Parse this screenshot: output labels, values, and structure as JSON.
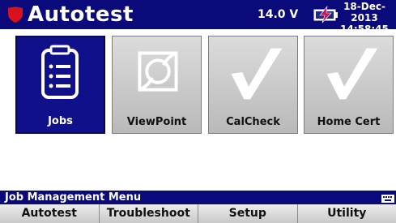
{
  "header": {
    "title": "Autotest",
    "voltage": "14.0 V",
    "date": "18-Dec-2013",
    "time": "14:58:45",
    "logo_icon": "red-shield-icon",
    "battery_icon": "battery-charging-icon"
  },
  "tiles": [
    {
      "label": "Jobs",
      "icon": "clipboard-list-icon",
      "selected": true
    },
    {
      "label": "ViewPoint",
      "icon": "fiber-endface-icon",
      "selected": false
    },
    {
      "label": "CalCheck",
      "icon": "checkmark-icon",
      "selected": false
    },
    {
      "label": "Home Cert",
      "icon": "checkmark-icon",
      "selected": false
    }
  ],
  "status": {
    "text": "Job Management Menu",
    "icon": "keyboard-icon"
  },
  "softkeys": [
    "Autotest",
    "Troubleshoot",
    "Setup",
    "Utility"
  ],
  "colors": {
    "titlebar": "#0a0a7a",
    "selected_tile": "#10108a",
    "logo": "#d8121c"
  }
}
